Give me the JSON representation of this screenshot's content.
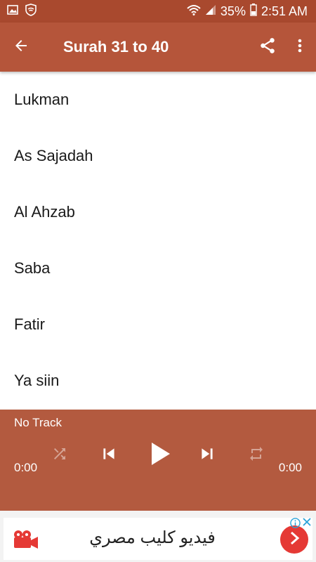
{
  "status_bar": {
    "battery": "35%",
    "time": "2:51 AM"
  },
  "app_bar": {
    "title": "Surah 31 to 40",
    "icons": [
      "back-arrow-icon",
      "share-icon",
      "more-vert-icon"
    ]
  },
  "surah_list": {
    "items": [
      {
        "label": "Lukman"
      },
      {
        "label": "As Sajadah"
      },
      {
        "label": "Al Ahzab"
      },
      {
        "label": "Saba"
      },
      {
        "label": "Fatir"
      },
      {
        "label": "Ya siin"
      }
    ]
  },
  "player": {
    "track": "No Track",
    "elapsed": "0:00",
    "duration": "0:00",
    "icons": [
      "shuffle-icon",
      "skip-previous-icon",
      "play-icon",
      "skip-next-icon",
      "repeat-icon"
    ]
  },
  "ad": {
    "text": "فيديو كليب مصري",
    "icons": [
      "video-camera-icon",
      "chevron-right-icon",
      "info-icon",
      "close-icon"
    ]
  },
  "colors": {
    "status_bar": "#a9492e",
    "app_bar": "#b5553a",
    "player": "#b35a3f",
    "ad_button": "#e53935"
  }
}
